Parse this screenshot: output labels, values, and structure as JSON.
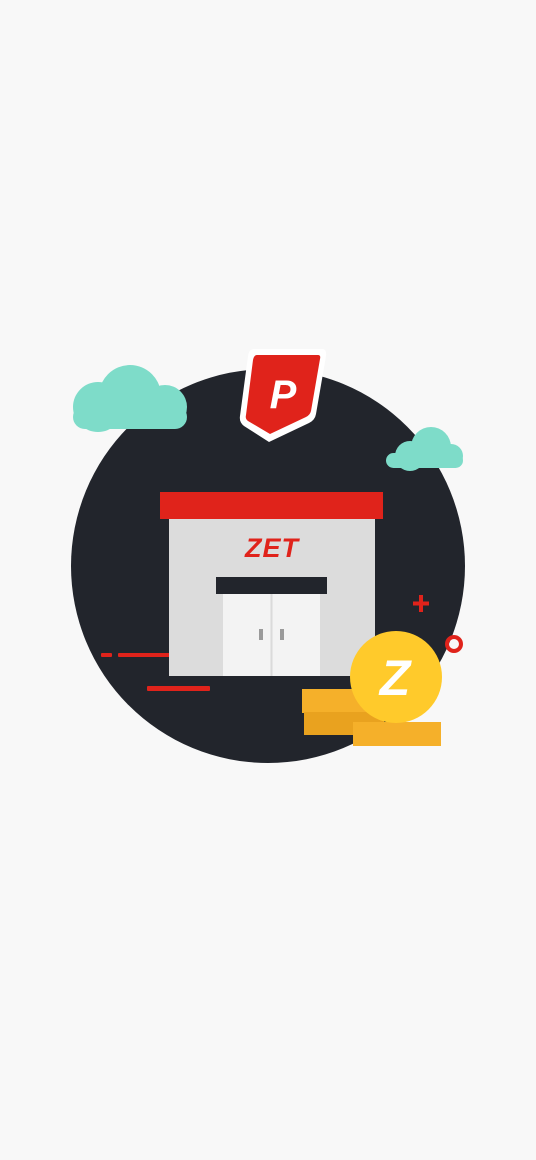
{
  "illustration": {
    "store_sign": "ZET",
    "pin_letter": "P",
    "coin_letter": "Z"
  },
  "colors": {
    "background": "#f8f8f8",
    "circle": "#22252c",
    "brand_red": "#e0231b",
    "cloud": "#7edcc9",
    "coin": "#ffca2b",
    "coin_stack": "#f5b02a",
    "store_wall": "#dcdcdc",
    "door": "#f3f3f3"
  },
  "icons": [
    "parking-pin-icon",
    "cloud-icon",
    "coin-icon",
    "plus-sparkle-icon",
    "ring-sparkle-icon",
    "store-icon"
  ]
}
